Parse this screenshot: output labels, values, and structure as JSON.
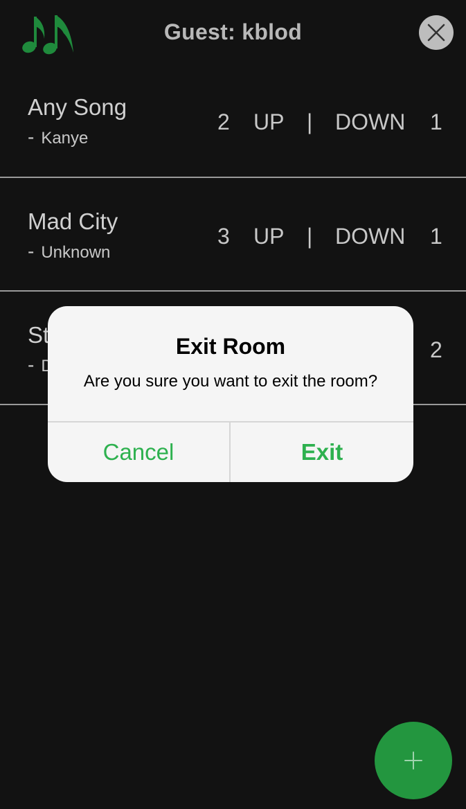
{
  "header": {
    "title": "Guest: kblod",
    "logo_icon": "music-notes-icon",
    "close_icon": "close-icon"
  },
  "songs": [
    {
      "title": "Any Song",
      "artist_dash": "-",
      "artist": "Kanye",
      "up_count": "2",
      "up_label": "UP",
      "separator": "|",
      "down_label": "DOWN",
      "down_count": "1"
    },
    {
      "title": "Mad City",
      "artist_dash": "-",
      "artist": "Unknown",
      "up_count": "3",
      "up_label": "UP",
      "separator": "|",
      "down_label": "DOWN",
      "down_count": "1"
    },
    {
      "title": "St",
      "artist_dash": "-",
      "artist": "D",
      "down_count": "2"
    }
  ],
  "dialog": {
    "title": "Exit Room",
    "message": "Are you sure you want to exit the room?",
    "cancel_label": "Cancel",
    "exit_label": "Exit"
  },
  "fab": {
    "icon": "plus-icon"
  },
  "colors": {
    "background": "#121212",
    "accent_green": "#2eb14f",
    "fab_green": "#23963f",
    "logo_green": "#1f8a3c"
  }
}
